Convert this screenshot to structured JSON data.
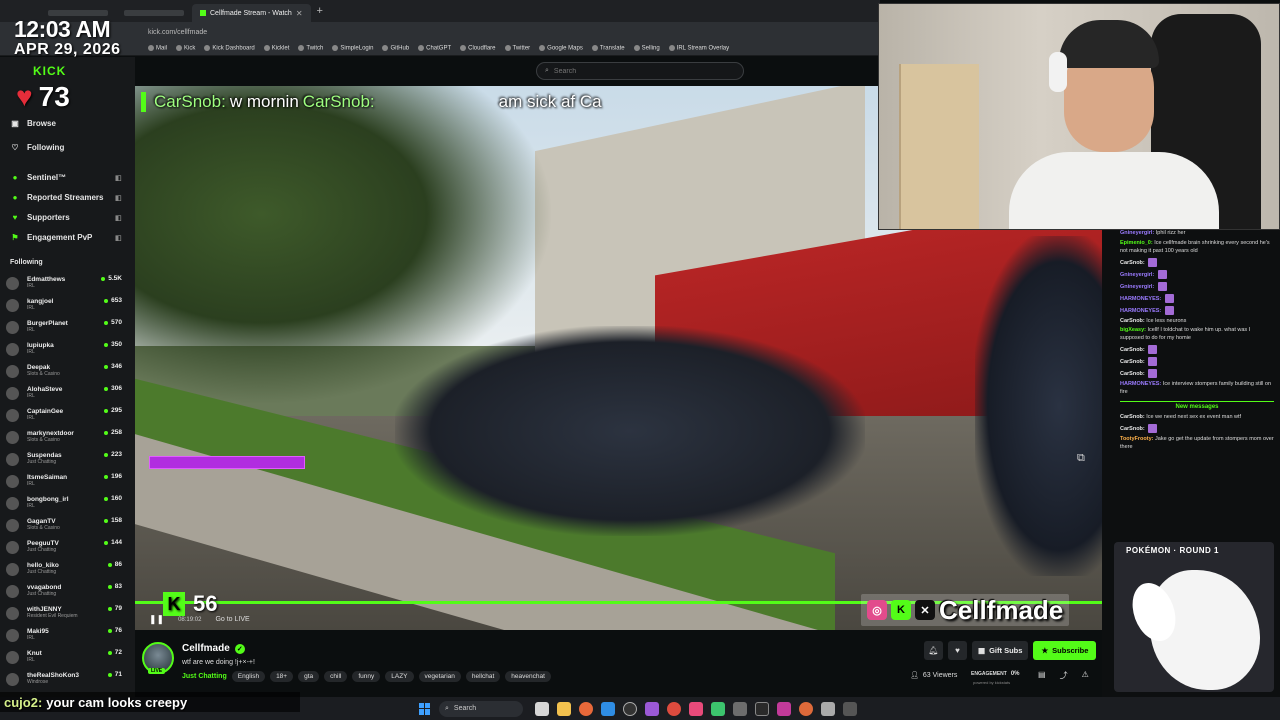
{
  "browser": {
    "tabs": [
      {
        "label": "Cellfmade Stream - Watch",
        "active": true
      }
    ],
    "url": "kick.com/cellfmade",
    "bookmarks": [
      "Mail",
      "Kick",
      "Kick Dashboard",
      "Kicklet",
      "Twitch",
      "SimpleLogin",
      "GitHub",
      "ChatGPT",
      "Cloudflare",
      "Twitter",
      "Google Maps",
      "Translate",
      "Selling",
      "IRL Stream Overlay"
    ]
  },
  "overlay": {
    "time": "12:03 AM",
    "date": "APR 29, 2026",
    "heart_count": "73",
    "kick_logo": "KICK"
  },
  "header": {
    "search_placeholder": "Search"
  },
  "sidebar": {
    "nav": [
      {
        "label": "Browse",
        "icon": "browse-icon"
      },
      {
        "label": "Following",
        "icon": "heart-icon"
      }
    ],
    "extensions": [
      {
        "label": "Sentinel™"
      },
      {
        "label": "Reported Streamers"
      },
      {
        "label": "Supporters"
      },
      {
        "label": "Engagement PvP"
      }
    ],
    "following_header": "Following",
    "following": [
      {
        "name": "Edmatthews",
        "category": "IRL",
        "viewers": "5.5K"
      },
      {
        "name": "kangjoel",
        "category": "IRL",
        "viewers": "653"
      },
      {
        "name": "BurgerPlanet",
        "category": "IRL",
        "viewers": "570"
      },
      {
        "name": "lupiupka",
        "category": "IRL",
        "viewers": "350"
      },
      {
        "name": "Deepak",
        "category": "Slots & Casino",
        "viewers": "346"
      },
      {
        "name": "AlohaSteve",
        "category": "IRL",
        "viewers": "306"
      },
      {
        "name": "CaptainGee",
        "category": "IRL",
        "viewers": "295"
      },
      {
        "name": "markynextdoor",
        "category": "Slots & Casino",
        "viewers": "258"
      },
      {
        "name": "Suspendas",
        "category": "Just Chatting",
        "viewers": "223"
      },
      {
        "name": "ItsmeSaiman",
        "category": "IRL",
        "viewers": "196"
      },
      {
        "name": "bongbong_irl",
        "category": "IRL",
        "viewers": "160"
      },
      {
        "name": "GaganTV",
        "category": "Slots & Casino",
        "viewers": "158"
      },
      {
        "name": "PeeguuTV",
        "category": "Just Chatting",
        "viewers": "144"
      },
      {
        "name": "hello_kiko",
        "category": "Just Chatting",
        "viewers": "86"
      },
      {
        "name": "vvagabond",
        "category": "Just Chatting",
        "viewers": "83"
      },
      {
        "name": "withJENNY",
        "category": "Resident Evil Requiem",
        "viewers": "79"
      },
      {
        "name": "Maki95",
        "category": "IRL",
        "viewers": "76"
      },
      {
        "name": "Knut",
        "category": "IRL",
        "viewers": "72"
      },
      {
        "name": "theRealShoKon3",
        "category": "Windrose",
        "viewers": "71"
      }
    ]
  },
  "video": {
    "chat_overlay_user": "CarSnob:",
    "chat_overlay_text": "w mornin",
    "chat_overlay_user2": "CarSnob:",
    "chat_overlay_tail": "am sick af Ca",
    "hud_count": "56",
    "timecode": "08:19:02",
    "go_live": "Go to LIVE",
    "social_name": "Cellfmade"
  },
  "chat": {
    "messages": [
      {
        "user": "Gnineyergirl:",
        "text": "Iphil rizz her",
        "color": "p"
      },
      {
        "user": "Epimenio_0:",
        "text": "Ice cellfmade brain shrinking every second he's not making it past 100 years old",
        "color": "g"
      },
      {
        "user": "CarSnob:",
        "text": "",
        "color": "w",
        "emote": true
      },
      {
        "user": "Gnineyergirl:",
        "text": "",
        "color": "p",
        "emote": true
      },
      {
        "user": "Gnineyergirl:",
        "text": "",
        "color": "p",
        "emote": true
      },
      {
        "user": "HARMONEYES:",
        "text": "",
        "color": "p",
        "emote": true
      },
      {
        "user": "HARMONEYES:",
        "text": "",
        "color": "p",
        "emote": true
      },
      {
        "user": "CarSnob:",
        "text": "Ice less neurons",
        "color": "w"
      },
      {
        "user": "bigXeasy:",
        "text": "Icellf I toldchat to wake him up. what was I supposed to do for my homie",
        "color": "g"
      },
      {
        "user": "CarSnob:",
        "text": "",
        "color": "w",
        "emote": true
      },
      {
        "user": "CarSnob:",
        "text": "",
        "color": "w",
        "emote": true
      },
      {
        "user": "CarSnob:",
        "text": "",
        "color": "w",
        "emote": true
      },
      {
        "user": "HARMONEYES:",
        "text": "Ice interview stompers family building still on fire",
        "color": "p"
      }
    ],
    "new_messages_label": "New messages",
    "messages_after": [
      {
        "user": "CarSnob:",
        "text": "Ice we need next sex ex event man wtf",
        "color": "w"
      },
      {
        "user": "CarSnob:",
        "text": "",
        "color": "w",
        "emote": true
      },
      {
        "user": "TootyFrooty:",
        "text": "Jake go get the update from stompers mom over there",
        "color": "o"
      }
    ],
    "pokemon_title": "POKÉMON · ROUND 1"
  },
  "stream": {
    "name": "Cellfmade",
    "title": "wtf are we doing !j+×-+!",
    "category": "Just Chatting",
    "tags": [
      "English",
      "18+",
      "gta",
      "chill",
      "funny",
      "LAZY",
      "vegetarian",
      "hellchat",
      "heavenchat"
    ],
    "live_badge": "LIVE",
    "gift_label": "Gift Subs",
    "subscribe_label": "Subscribe",
    "viewers_label": "63 Viewers",
    "engagement_label": "ENGAGEMENT",
    "engagement_pct": "0%",
    "engagement_powered": "powered by kickstats"
  },
  "bottom_chat": {
    "user": "cujo2:",
    "text": "your cam looks creepy"
  },
  "taskbar": {
    "search_label": "Search"
  }
}
